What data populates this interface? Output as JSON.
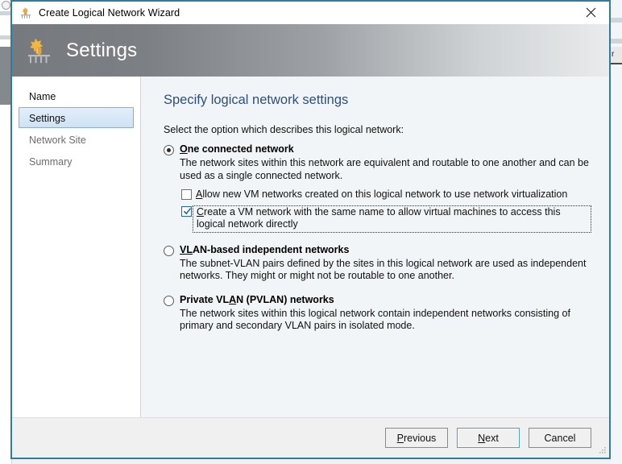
{
  "window": {
    "title": "Create Logical Network Wizard",
    "title_icon": "logical-network-icon",
    "close_icon": "close-icon",
    "banner_title": "Settings",
    "banner_icon": "logical-network-settings-icon",
    "accent_color": "#2e7d9e",
    "banner_gradient_from": "#76797d",
    "banner_gradient_to": "#e9ebec"
  },
  "sidebar": {
    "items": [
      {
        "label": "Name",
        "state": "done"
      },
      {
        "label": "Settings",
        "state": "selected"
      },
      {
        "label": "Network Site",
        "state": "pending"
      },
      {
        "label": "Summary",
        "state": "pending"
      }
    ],
    "selected_bg": "#cfe2f4",
    "selected_border": "#8fafc9"
  },
  "main": {
    "heading": "Specify logical network settings",
    "heading_color": "#2f4f7a",
    "lead": "Select the option which describes this logical network:",
    "options": [
      {
        "id": "one-connected-network",
        "label_pre": "",
        "label_accel": "O",
        "label_post": "ne connected network",
        "selected": true,
        "description": "The network sites within this network are equivalent and routable to one another and can be used as a single connected network."
      },
      {
        "id": "vlan-based-independent-networks",
        "label_pre": "",
        "label_accel": "VL",
        "label_post": "AN-based independent networks",
        "selected": false,
        "description": "The subnet-VLAN pairs defined by the sites in this logical network are used as independent networks. They might or might not be routable to one another."
      },
      {
        "id": "private-vlan-networks",
        "label_pre": "Private VL",
        "label_accel": "A",
        "label_post": "N (PVLAN) networks",
        "selected": false,
        "description": "The network sites within this logical network contain independent networks consisting of primary and secondary VLAN pairs in isolated mode."
      }
    ],
    "checkboxes": [
      {
        "id": "allow-network-virtualization",
        "label_accel": "A",
        "label_post": "llow new VM networks created on this logical network to use network virtualization",
        "checked": false,
        "focused": false
      },
      {
        "id": "create-vm-network-same-name",
        "label_accel": "C",
        "label_post": "reate a VM network with the same name to allow virtual machines to access this logical network directly",
        "checked": true,
        "focused": true,
        "check_color": "#1669b5"
      }
    ]
  },
  "footer": {
    "buttons": [
      {
        "id": "previous",
        "accel": "P",
        "post": "revious",
        "default": false
      },
      {
        "id": "next",
        "accel": "N",
        "post": "ext",
        "default": true
      },
      {
        "id": "cancel",
        "accel": "",
        "post": "Cancel",
        "default": false
      }
    ],
    "resize_grip": "resize-grip-icon"
  }
}
